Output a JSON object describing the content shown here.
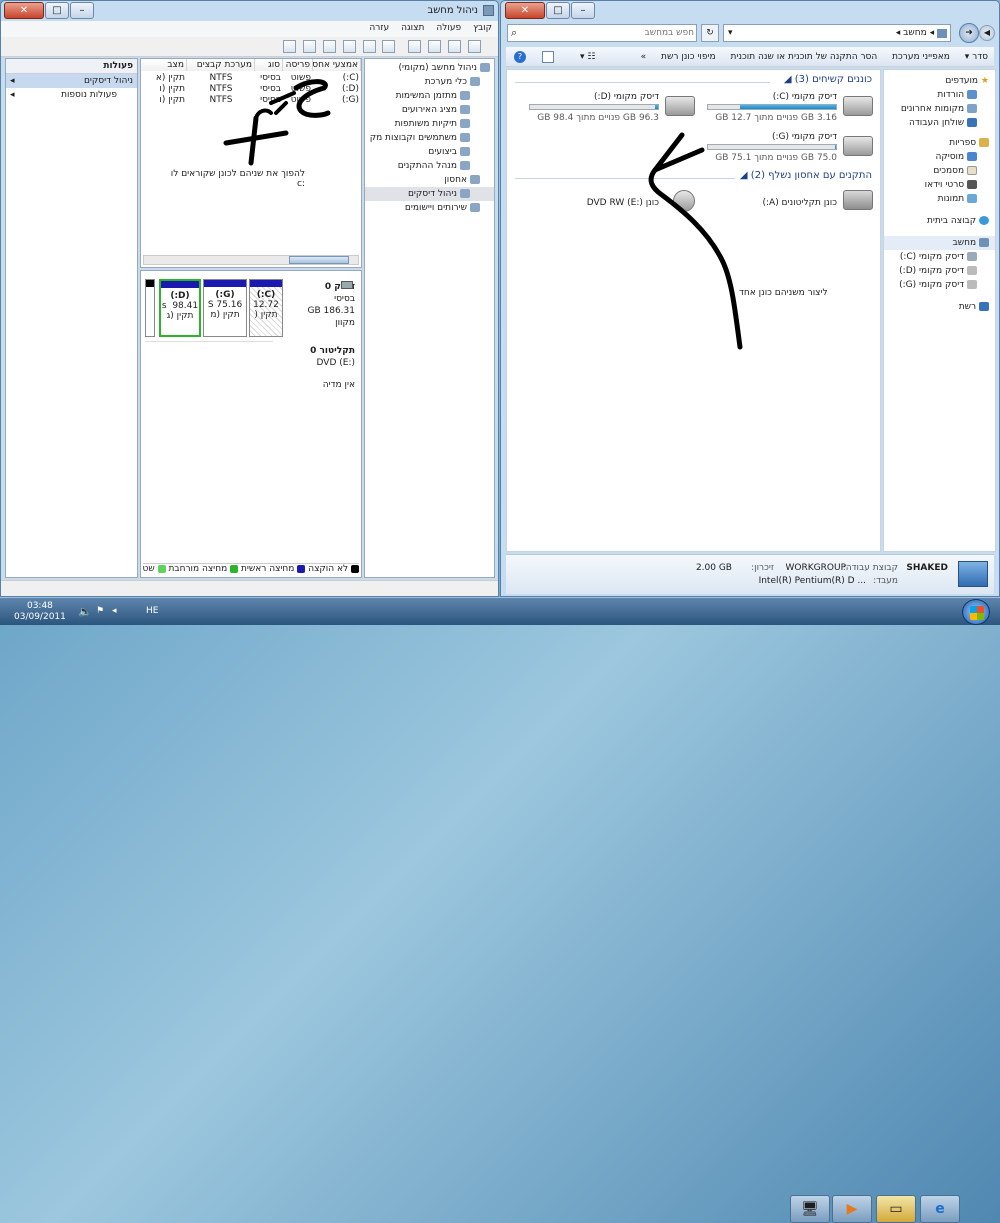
{
  "taskbar": {
    "time": "03:48",
    "date": "03/09/2011",
    "lang": "HE",
    "start_icon": "windows-orb-icon"
  },
  "cm": {
    "title": "ניהול מחשב",
    "menu": [
      "קובץ",
      "פעולה",
      "תצוגה",
      "עזרה"
    ],
    "tree": [
      "ניהול מחשב (מקומי)",
      "כלי מערכת",
      "מתזמן המשימות",
      "מציג האירועים",
      "תיקיות משותפות",
      "משתמשים וקבוצות מק",
      "ביצועים",
      "מנהל ההתקנים",
      "אחסון",
      "ניהול דיסקים",
      "שירותים ויישומים"
    ],
    "columns": [
      "אמצעי אחסון",
      "פריסה",
      "סוג",
      "מערכת קבצים",
      "מצב"
    ],
    "volumes": [
      {
        "vol": "(C:)",
        "layout": "פשוט",
        "type": "בסיסי",
        "fs": "NTFS",
        "status": "תקין (א"
      },
      {
        "vol": "(D:)",
        "layout": "פשוט",
        "type": "בסיסי",
        "fs": "NTFS",
        "status": "תקין (ו"
      },
      {
        "vol": "(G:)",
        "layout": "פשוט",
        "type": "בסיסי",
        "fs": "NTFS",
        "status": "תקין (ו"
      }
    ],
    "note1": "להפוך את שניהם לכונן שקוראים לו",
    "note2": "c:",
    "disk0": {
      "name": "דיסק 0",
      "type": "בסיסי",
      "size": "186.31 GB",
      "state": "מקוון"
    },
    "parts": [
      {
        "label": "(C:)",
        "size": "12.72",
        "state": "תקין ("
      },
      {
        "label": "(G:)",
        "size": "75.16 S",
        "state": "תקין (מ"
      },
      {
        "label": "(D:)",
        "size": "98.41 ⁠ s",
        "state": "תקין (ג"
      }
    ],
    "cdrom": {
      "name": "תקליטור 0",
      "type": "DVD (E:)",
      "state": "אין מדיה"
    },
    "legend": [
      "לא הוקצה",
      "מחיצה ראשית",
      "מחיצה מורחבת",
      "שט"
    ],
    "actions": {
      "title": "פעולות",
      "item1": "ניהול דיסקים",
      "item2": "פעולות נוספות"
    },
    "colors": {
      "unallocated": "#000000",
      "primary": "#1a1ab0",
      "extended": "#2bb52b",
      "free": "#5fd35f"
    }
  },
  "ex": {
    "breadcrumb": "מחשב",
    "search_placeholder": "חפש במחשב",
    "toolbar": [
      "סדר",
      "מאפייני מערכת",
      "הסר התקנה של תוכנית או שנה תוכנית",
      "מיפוי כונן רשת",
      "»"
    ],
    "section_hdd": "כוננים קשיחים (3)",
    "section_rem": "התקנים עם אחסון נשלף (2)",
    "drives": [
      {
        "name": "דיסק מקומי (C:)",
        "free": "3.16 GB פנויים מתוך 12.7 GB",
        "used": 0.75
      },
      {
        "name": "דיסק מקומי (D:)",
        "free": "96.3 GB פנויים מתוך 98.4 GB",
        "used": 0.02
      },
      {
        "name": "דיסק מקומי (G:)",
        "free": "75.0 GB פנויים מתוך 75.1 GB",
        "used": 0.01
      }
    ],
    "removable": [
      {
        "name": "כונן תקליטונים (A:)",
        "icon": "floppy-icon"
      },
      {
        "name": "כונן DVD RW (E:)",
        "icon": "dvd-icon"
      }
    ],
    "handnote": "ליצור משניהם כונן אחד",
    "nav": {
      "favorites": "מועדפים",
      "fav": [
        "הורדות",
        "מקומות אחרונים",
        "שולחן העבודה"
      ],
      "libraries": "ספריות",
      "libs": [
        "מוסיקה",
        "מסמכים",
        "סרטי וידאו",
        "תמונות"
      ],
      "homegroup": "קבוצה ביתית",
      "computer": "מחשב",
      "comp": [
        "דיסק מקומי (C:)",
        "דיסק מקומי (D:)",
        "דיסק מקומי (G:)"
      ],
      "network": "רשת"
    },
    "details": {
      "pcname": "SHAKED",
      "wg_label": "קבוצת עבודה:",
      "wg": "WORKGROUP",
      "mem_label": "זיכרון:",
      "mem": "2.00 GB",
      "cpu_label": "מעבד:",
      "cpu": "Intel(R) Pentium(R) D ..."
    }
  }
}
